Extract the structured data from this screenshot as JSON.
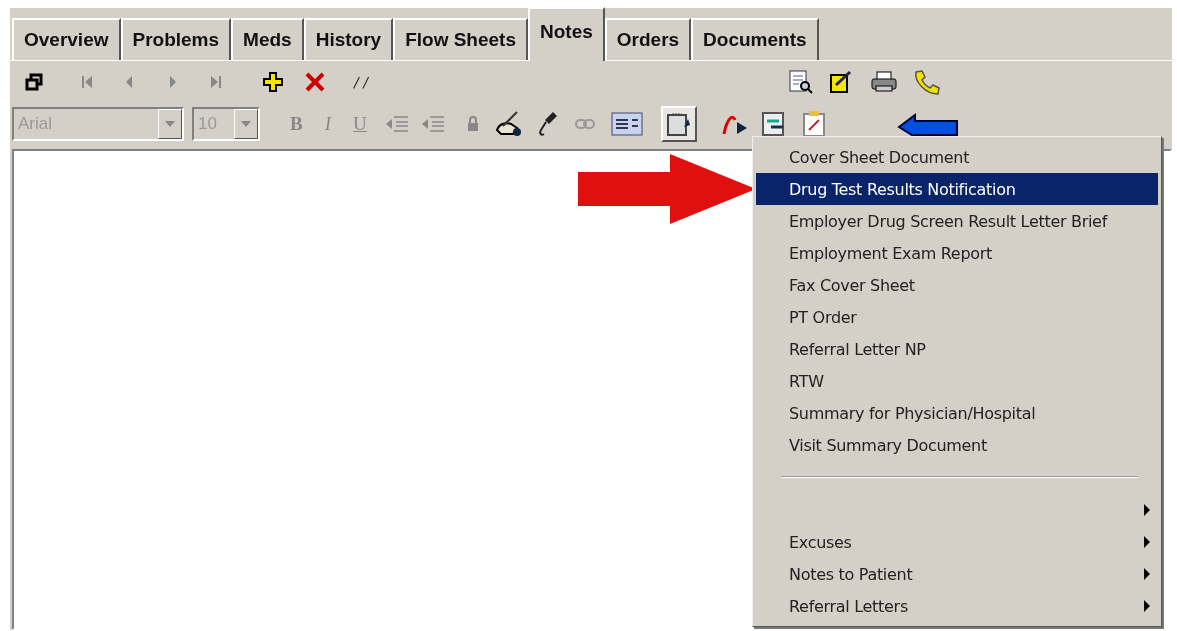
{
  "tabs": [
    {
      "label": "Overview",
      "selected": false
    },
    {
      "label": "Problems",
      "selected": false
    },
    {
      "label": "Meds",
      "selected": false
    },
    {
      "label": "History",
      "selected": false
    },
    {
      "label": "Flow Sheets",
      "selected": false
    },
    {
      "label": "Notes",
      "selected": true
    },
    {
      "label": "Orders",
      "selected": false
    },
    {
      "label": "Documents",
      "selected": false
    }
  ],
  "toolbar": {
    "date_button": "/ /",
    "font_select": {
      "value": "Arial",
      "disabled": true
    },
    "size_select": {
      "value": "10",
      "disabled": true
    },
    "format_buttons": [
      "B",
      "I",
      "U"
    ],
    "template_button": {
      "pressed": true
    }
  },
  "template_menu": {
    "items": [
      {
        "kind": "item",
        "label": "Cover Sheet Document",
        "selected": false
      },
      {
        "kind": "item",
        "label": "Drug Test Results Notification",
        "selected": true
      },
      {
        "kind": "item",
        "label": "Employer Drug Screen Result Letter Brief",
        "selected": false
      },
      {
        "kind": "item",
        "label": "Employment Exam Report",
        "selected": false
      },
      {
        "kind": "item",
        "label": "Fax Cover Sheet",
        "selected": false
      },
      {
        "kind": "item",
        "label": "PT Order",
        "selected": false
      },
      {
        "kind": "item",
        "label": "Referral Letter NP",
        "selected": false
      },
      {
        "kind": "item",
        "label": "RTW",
        "selected": false
      },
      {
        "kind": "item",
        "label": "Summary for Physician/Hospital",
        "selected": false
      },
      {
        "kind": "item",
        "label": "Visit Summary Document",
        "selected": false
      },
      {
        "kind": "separator"
      },
      {
        "kind": "submenu",
        "selected": false
      },
      {
        "kind": "submenu",
        "label": "Excuses",
        "selected": false
      },
      {
        "kind": "submenu",
        "label": "Notes to Patient",
        "selected": false
      },
      {
        "kind": "submenu",
        "label": "Referral Letters",
        "selected": false
      }
    ]
  }
}
